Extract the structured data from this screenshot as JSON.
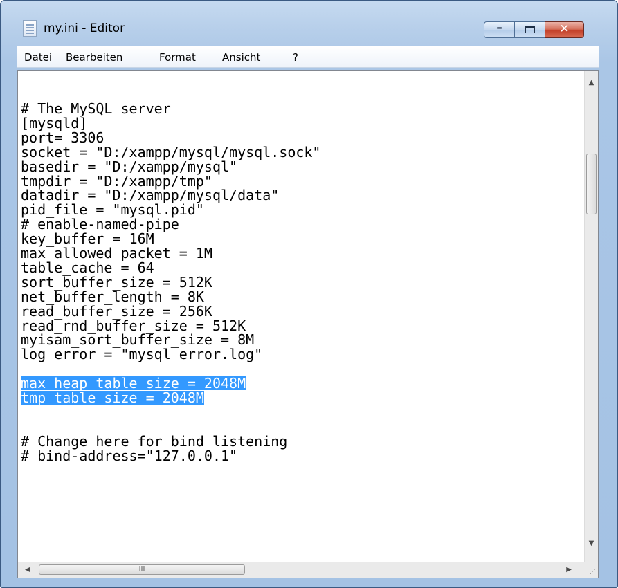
{
  "window": {
    "title": "my.ini - Editor",
    "minimize_glyph": "–",
    "close_glyph": "✕"
  },
  "menu": [
    {
      "label": "Datei",
      "mnemonic": "D"
    },
    {
      "label": "Bearbeiten",
      "mnemonic": "B"
    },
    {
      "label": "Format",
      "mnemonic": "o"
    },
    {
      "label": "Ansicht",
      "mnemonic": "A"
    },
    {
      "label": "?",
      "mnemonic": "?"
    }
  ],
  "editor": {
    "lines": [
      "# The MySQL server",
      "[mysqld]",
      "port= 3306",
      "socket = \"D:/xampp/mysql/mysql.sock\"",
      "basedir = \"D:/xampp/mysql\"",
      "tmpdir = \"D:/xampp/tmp\"",
      "datadir = \"D:/xampp/mysql/data\"",
      "pid_file = \"mysql.pid\"",
      "# enable-named-pipe",
      "key_buffer = 16M",
      "max_allowed_packet = 1M",
      "table_cache = 64",
      "sort_buffer_size = 512K",
      "net_buffer_length = 8K",
      "read_buffer_size = 256K",
      "read_rnd_buffer_size = 512K",
      "myisam_sort_buffer_size = 8M",
      "log_error = \"mysql_error.log\"",
      "",
      "max_heap_table_size = 2048M",
      "tmp_table_size = 2048M",
      "",
      "",
      "# Change here for bind listening",
      "# bind-address=\"127.0.0.1\""
    ],
    "selected_lines": [
      19,
      20
    ]
  },
  "scrollbars": {
    "up_arrow": "▲",
    "down_arrow": "▼",
    "left_arrow": "◀",
    "right_arrow": "▶",
    "grip_glyph": "III",
    "size_grip": "⋰"
  }
}
